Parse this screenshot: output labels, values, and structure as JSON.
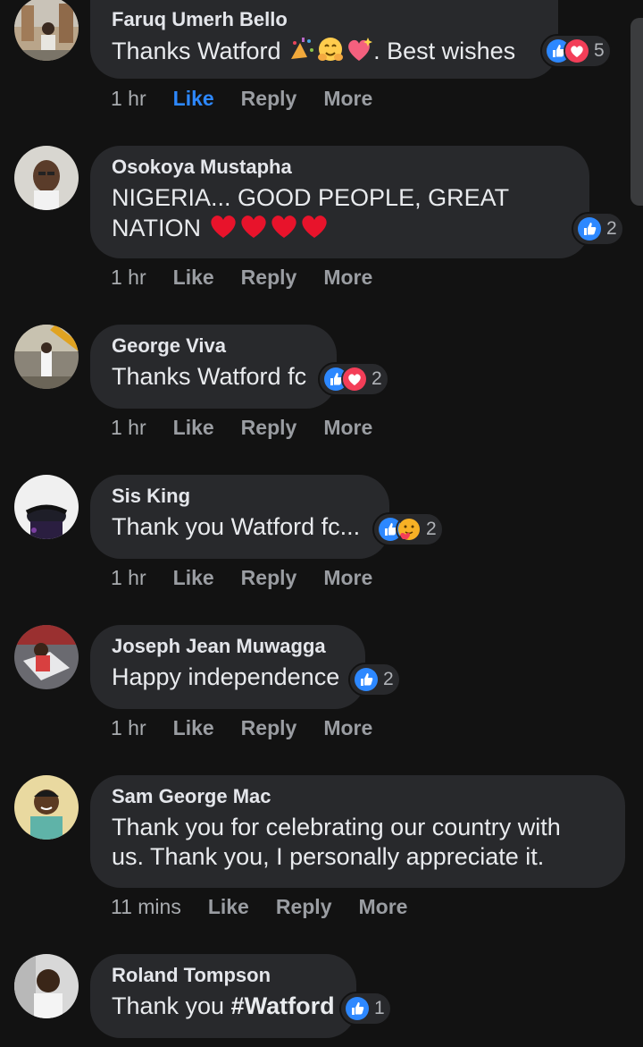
{
  "comments": [
    {
      "author": "Faruq Umerh Bello",
      "text_before": "Thanks Watford ",
      "text_after": ". Best wishes",
      "time": "1 hr",
      "like_label": "Like",
      "reply_label": "Reply",
      "more_label": "More",
      "reaction_count": "5",
      "liked": true
    },
    {
      "author": "Osokoya Mustapha",
      "text": "NIGERIA... GOOD PEOPLE, GREAT\nNATION ",
      "time": "1 hr",
      "like_label": "Like",
      "reply_label": "Reply",
      "more_label": "More",
      "reaction_count": "2"
    },
    {
      "author": "George Viva",
      "text": "Thanks Watford fc",
      "time": "1 hr",
      "like_label": "Like",
      "reply_label": "Reply",
      "more_label": "More",
      "reaction_count": "2"
    },
    {
      "author": "Sis King",
      "text": "Thank you Watford fc...",
      "time": "1 hr",
      "like_label": "Like",
      "reply_label": "Reply",
      "more_label": "More",
      "reaction_count": "2"
    },
    {
      "author": "Joseph Jean Muwagga",
      "text": "Happy independence",
      "time": "1 hr",
      "like_label": "Like",
      "reply_label": "Reply",
      "more_label": "More",
      "reaction_count": "2"
    },
    {
      "author": "Sam George Mac",
      "text": "Thank you for celebrating our country with\nus. Thank you, I personally appreciate it.",
      "time": "11 mins",
      "like_label": "Like",
      "reply_label": "Reply",
      "more_label": "More"
    },
    {
      "author": "Roland Tompson",
      "text_before": "Thank you ",
      "hashtag": "#Watford",
      "reaction_count": "1"
    }
  ],
  "colors": {
    "background": "#121212",
    "bubble": "#28292c",
    "like_blue": "#2d88ff",
    "love_red": "#f33e58"
  },
  "icons": {
    "like": "thumbs-up-icon",
    "love": "heart-icon",
    "care": "care-face-icon",
    "heart_emoji": "red-heart-emoji"
  }
}
